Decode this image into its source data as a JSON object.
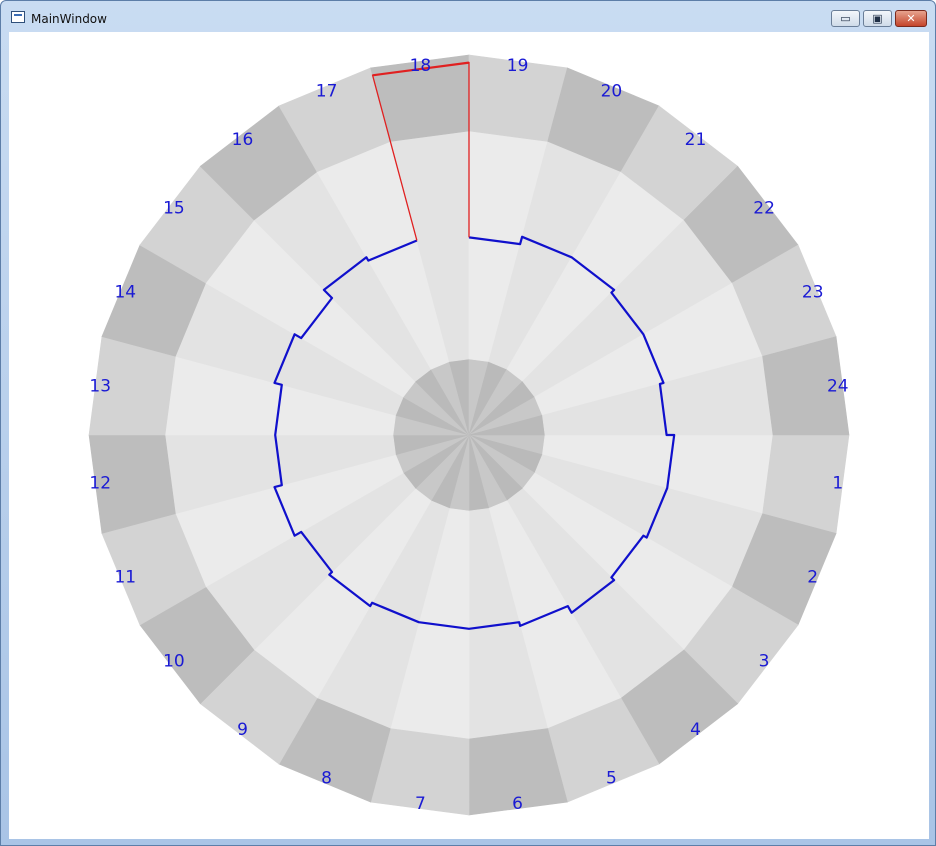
{
  "window": {
    "title": "MainWindow",
    "controls": {
      "minimize": "▭",
      "maximize": "▣",
      "close": "✕"
    }
  },
  "chart_data": {
    "type": "radial",
    "angle_labels": [
      "1",
      "2",
      "3",
      "4",
      "5",
      "6",
      "7",
      "8",
      "9",
      "10",
      "11",
      "12",
      "13",
      "14",
      "15",
      "16",
      "17",
      "18",
      "19",
      "20",
      "21",
      "22",
      "23",
      "24"
    ],
    "label_color": "#1a1ad4",
    "series": [
      {
        "color": "#1010cc",
        "values": [
          0.54,
          0.54,
          0.53,
          0.54,
          0.52,
          0.51,
          0.51,
          0.51,
          0.52,
          0.51,
          0.53,
          0.51,
          0.51,
          0.53,
          0.51,
          0.54,
          0.53,
          0.51,
          0.52,
          0.54,
          0.54,
          0.53,
          0.53,
          0.52
        ]
      }
    ],
    "highlight": {
      "label": "18",
      "color": "#e02020",
      "value": 0.98
    },
    "palette": {
      "inner_band": [
        "#c8c8c8",
        "#bababa"
      ],
      "middle_band": [
        "#ebebeb",
        "#e3e3e3"
      ],
      "outer_band": [
        "#d3d3d3",
        "#bdbdbd"
      ]
    }
  }
}
